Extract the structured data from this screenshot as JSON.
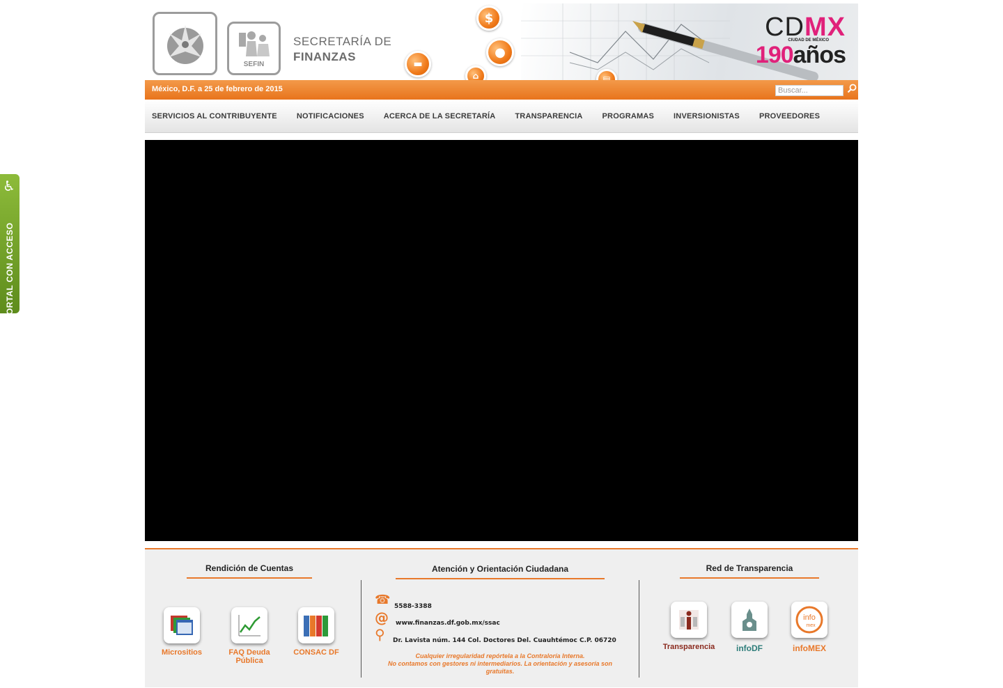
{
  "accessibility_tab": {
    "label": "PORTAL CON ACCESO"
  },
  "header": {
    "logo_sefin_text": "SEFIN",
    "title_line1": "SECRETARÍA DE",
    "title_line2": "FINANZAS",
    "cdmx": {
      "cd": "CD",
      "mx": "MX",
      "sub": "CIUDAD DE MÉXICO",
      "years_num": "190",
      "years_word": "años"
    },
    "orb_dollar": "$"
  },
  "topbar": {
    "date": "México, D.F. a 25 de febrero de 2015",
    "search_placeholder": "Buscar..."
  },
  "nav": {
    "items": [
      "SERVICIOS AL CONTRIBUYENTE",
      "NOTIFICACIONES",
      "ACERCA DE LA SECRETARÍA",
      "TRANSPARENCIA",
      "PROGRAMAS",
      "INVERSIONISTAS",
      "PROVEEDORES"
    ]
  },
  "footer": {
    "rendicion": {
      "title": "Rendición de Cuentas",
      "items": [
        "Micrositios",
        "FAQ Deuda Pública",
        "CONSAC DF"
      ]
    },
    "atencion": {
      "title": "Atención y Orientación Ciudadana",
      "phone": "5588-3388",
      "web": "www.finanzas.df.gob.mx/ssac",
      "address": "Dr. Lavista núm. 144 Col. Doctores Del. Cuauhtémoc C.P. 06720",
      "notice_line1": "Cualquier irregularidad repórtela a la Contraloría Interna.",
      "notice_line2": "No contamos con gestores ni intermediarios. La orientación y asesoría son gratuitas."
    },
    "red": {
      "title": "Red de Transparencia",
      "items": [
        "Transparencia",
        "infoDF",
        "infoMEX"
      ],
      "colors": {
        "transparencia": "#8a2a1e",
        "infodf": "#2e7d7a",
        "infomex": "#e8782a"
      }
    }
  },
  "colors": {
    "accent": "#e8782a",
    "cdmx_pink": "#e0217a",
    "accessibility_green": "#6e9e26"
  }
}
